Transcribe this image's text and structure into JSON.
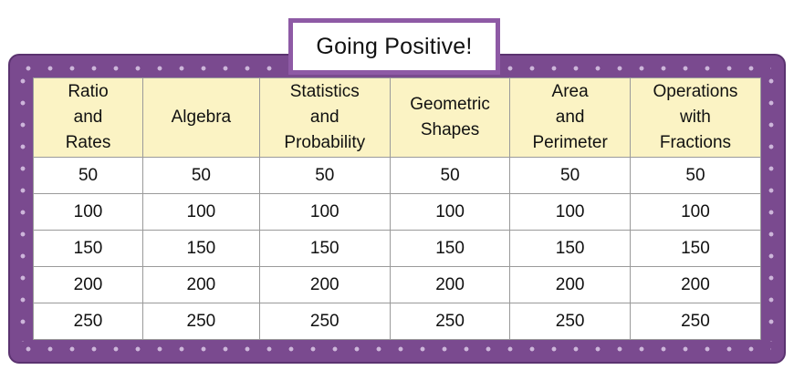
{
  "board": {
    "title": "Going Positive!",
    "colors": {
      "frame": "#7a4a8f",
      "header_fill": "#fbf3c4",
      "title_border": "#8e5aa5"
    },
    "categories": [
      "Ratio\nand\nRates",
      "Algebra",
      "Statistics\nand\nProbability",
      "Geometric\nShapes",
      "Area\nand\nPerimeter",
      "Operations\nwith\nFractions"
    ],
    "rows": [
      [
        "50",
        "50",
        "50",
        "50",
        "50",
        "50"
      ],
      [
        "100",
        "100",
        "100",
        "100",
        "100",
        "100"
      ],
      [
        "150",
        "150",
        "150",
        "150",
        "150",
        "150"
      ],
      [
        "200",
        "200",
        "200",
        "200",
        "200",
        "200"
      ],
      [
        "250",
        "250",
        "250",
        "250",
        "250",
        "250"
      ]
    ]
  }
}
